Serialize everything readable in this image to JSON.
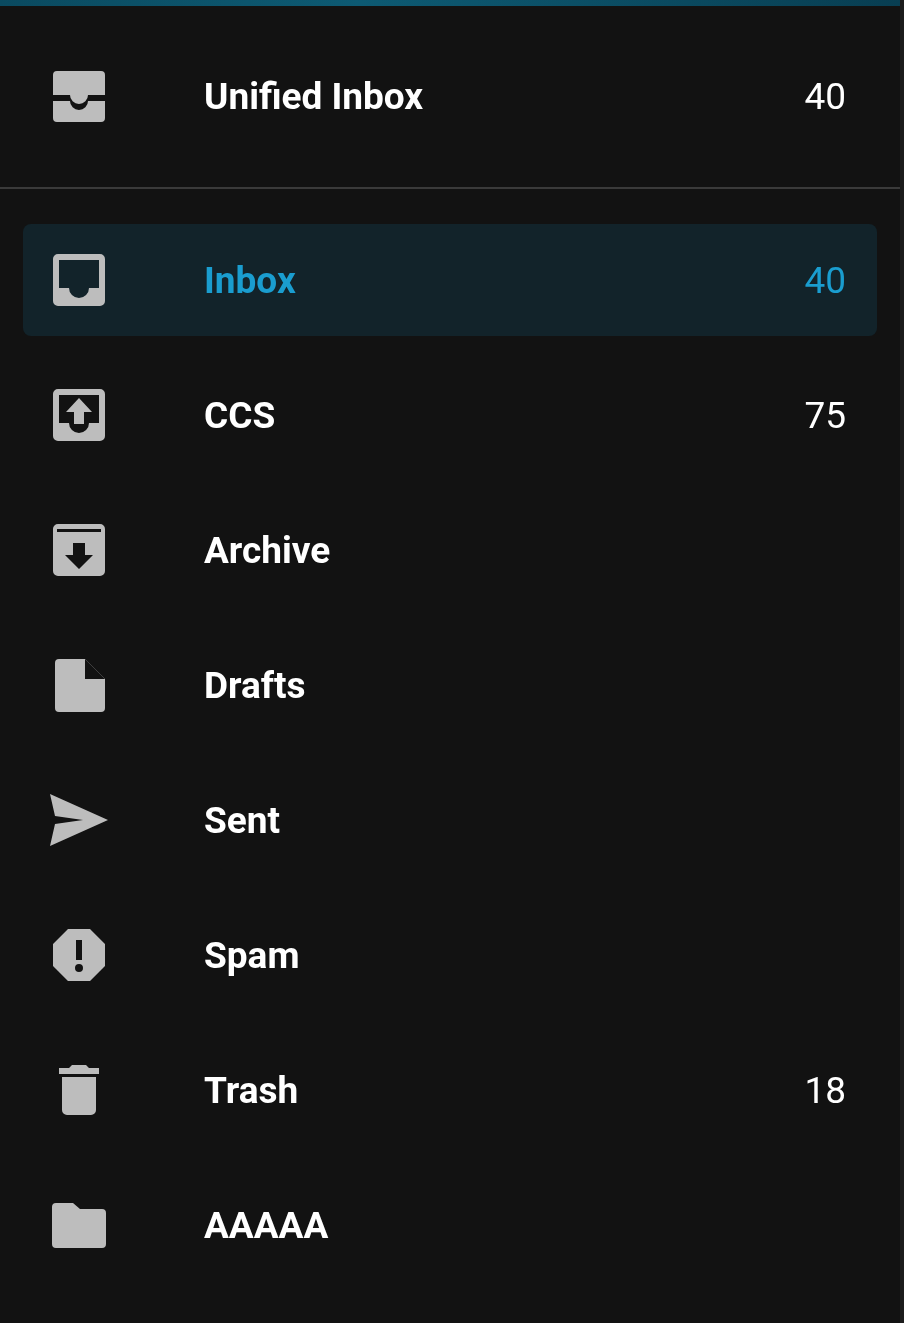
{
  "unified": {
    "label": "Unified Inbox",
    "count": "40",
    "kind": "unified"
  },
  "folders": [
    {
      "label": "Inbox",
      "count": "40",
      "kind": "inbox",
      "selected": true
    },
    {
      "label": "CCS",
      "count": "75",
      "kind": "outbox",
      "selected": false
    },
    {
      "label": "Archive",
      "kind": "archive",
      "selected": false
    },
    {
      "label": "Drafts",
      "kind": "draft",
      "selected": false
    },
    {
      "label": "Sent",
      "kind": "sent",
      "selected": false
    },
    {
      "label": "Spam",
      "kind": "spam",
      "selected": false
    },
    {
      "label": "Trash",
      "count": "18",
      "kind": "trash",
      "selected": false
    },
    {
      "label": "AAAAA",
      "kind": "folder",
      "selected": false
    }
  ]
}
